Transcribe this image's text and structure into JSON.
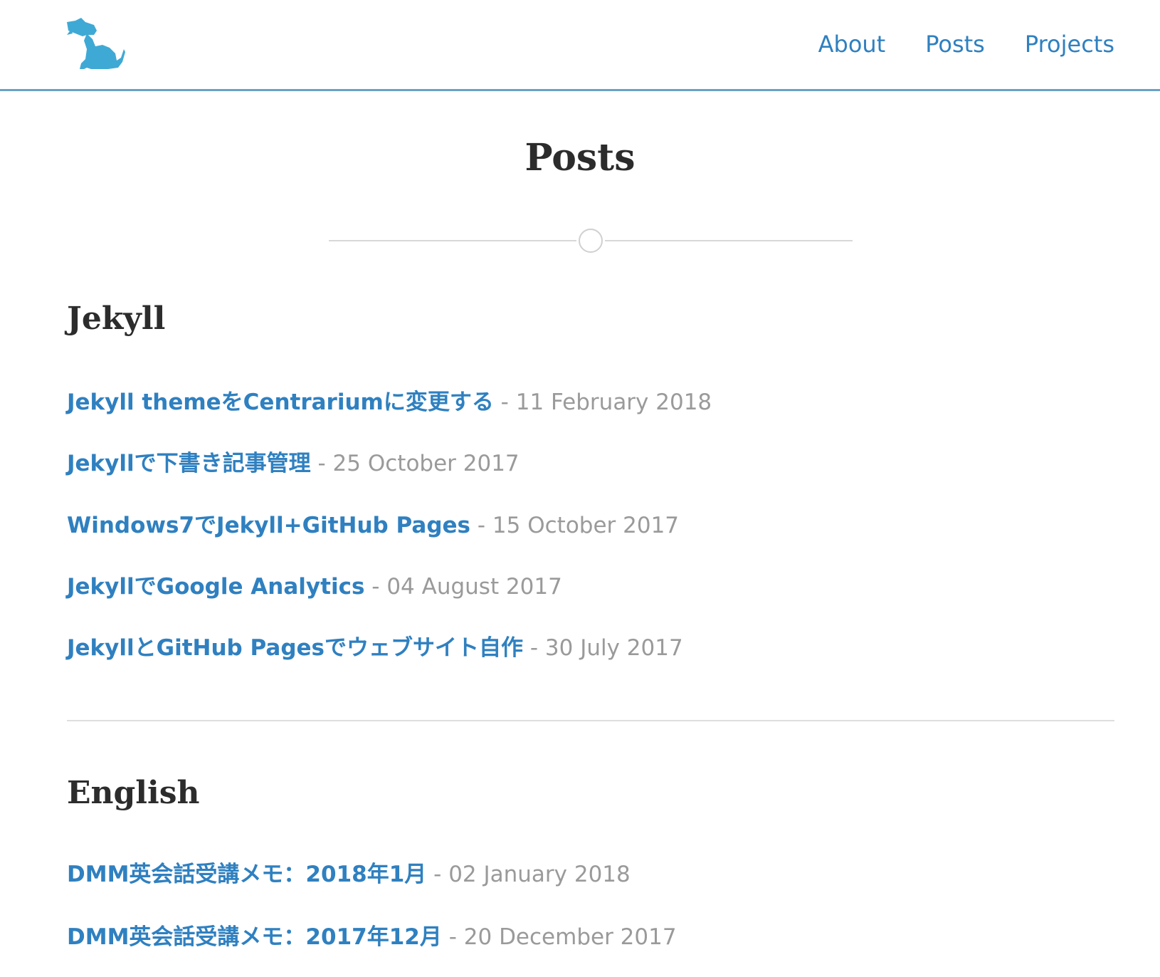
{
  "colors": {
    "accent": "#2f80c0",
    "header_border": "#6aa2c6",
    "logo": "#3fa9d5",
    "heading": "#2c2c2c",
    "date": "#9a9a9a",
    "divider": "#dedede"
  },
  "header": {
    "logo_icon": "dog-logo-icon",
    "nav": [
      {
        "label": "About"
      },
      {
        "label": "Posts"
      },
      {
        "label": "Projects"
      }
    ]
  },
  "page": {
    "title": "Posts"
  },
  "sections": [
    {
      "heading": "Jekyll",
      "posts": [
        {
          "title": "Jekyll themeをCentrariumに変更する",
          "sep": " - ",
          "date": "11 February 2018"
        },
        {
          "title": "Jekyllで下書き記事管理",
          "sep": " - ",
          "date": "25 October 2017"
        },
        {
          "title": "Windows7でJekyll+GitHub Pages",
          "sep": " - ",
          "date": "15 October 2017"
        },
        {
          "title": "JekyllでGoogle Analytics",
          "sep": " - ",
          "date": "04 August 2017"
        },
        {
          "title": "JekyllとGitHub Pagesでウェブサイト自作",
          "sep": " - ",
          "date": "30 July 2017"
        }
      ]
    },
    {
      "heading": "English",
      "posts": [
        {
          "title": "DMM英会話受講メモ：2018年1月",
          "sep": " - ",
          "date": "02 January 2018"
        },
        {
          "title": "DMM英会話受講メモ：2017年12月",
          "sep": " - ",
          "date": "20 December 2017"
        }
      ]
    }
  ]
}
